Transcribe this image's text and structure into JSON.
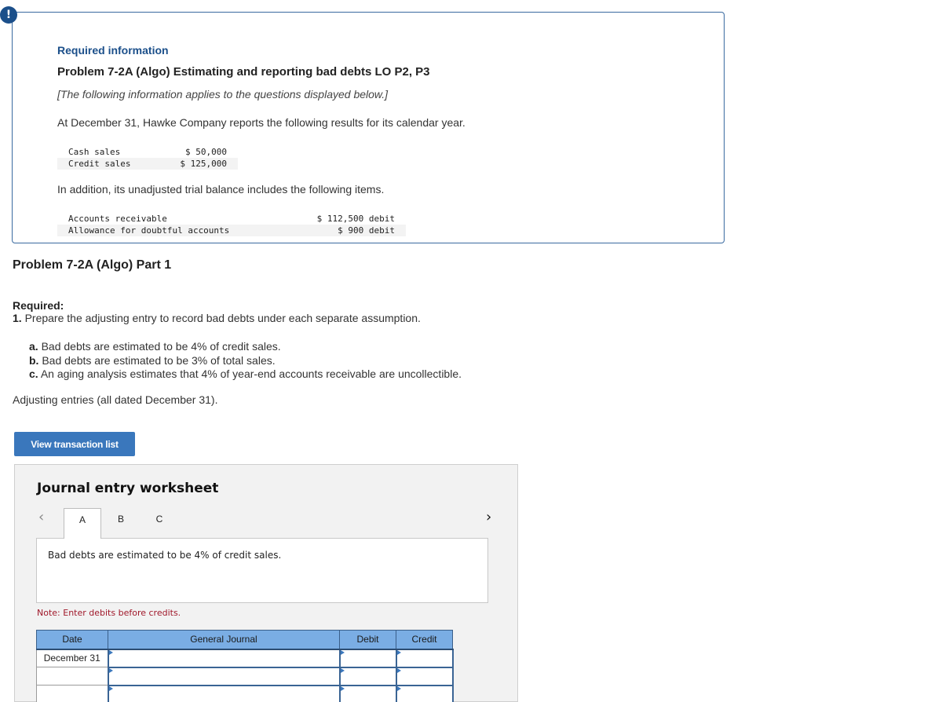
{
  "info_box": {
    "alert_icon": "!",
    "required_information": "Required information",
    "problem_title": "Problem 7-2A (Algo) Estimating and reporting bad debts LO P2, P3",
    "applies_note": "[The following information applies to the questions displayed below.]",
    "intro": "At December 31, Hawke Company reports the following results for its calendar year.",
    "sales": [
      {
        "label": "Cash sales",
        "amount": "$ 50,000"
      },
      {
        "label": "Credit sales",
        "amount": "$ 125,000"
      }
    ],
    "intro2": "In addition, its unadjusted trial balance includes the following items.",
    "trial_balance": [
      {
        "label": "Accounts receivable",
        "amount": "$ 112,500 debit"
      },
      {
        "label": "Allowance for doubtful accounts",
        "amount": "$ 900 debit"
      }
    ]
  },
  "part": {
    "title": "Problem 7-2A (Algo) Part 1",
    "required_label": "Required:",
    "requirement_number": "1.",
    "requirement_text": "Prepare the adjusting entry to record bad debts under each separate assumption.",
    "assumptions": [
      {
        "letter": "a.",
        "text": "Bad debts are estimated to be 4% of credit sales."
      },
      {
        "letter": "b.",
        "text": "Bad debts are estimated to be 3% of total sales."
      },
      {
        "letter": "c.",
        "text": "An aging analysis estimates that 4% of year-end accounts receivable are uncollectible."
      }
    ],
    "adjusting_note": "Adjusting entries (all dated December 31)."
  },
  "view_button": "View transaction list",
  "worksheet": {
    "title": "Journal entry worksheet",
    "prev_icon": "‹",
    "next_icon": "›",
    "tabs": [
      {
        "label": "A",
        "active": true
      },
      {
        "label": "B",
        "active": false
      },
      {
        "label": "C",
        "active": false
      }
    ],
    "description": "Bad debts are estimated to be 4% of credit sales.",
    "note": "Note: Enter debits before credits.",
    "columns": [
      "Date",
      "General Journal",
      "Debit",
      "Credit"
    ],
    "rows": [
      {
        "date": "December 31",
        "account": "",
        "debit": "",
        "credit": ""
      },
      {
        "date": "",
        "account": "",
        "debit": "",
        "credit": ""
      },
      {
        "date": "",
        "account": "",
        "debit": "",
        "credit": ""
      }
    ]
  }
}
